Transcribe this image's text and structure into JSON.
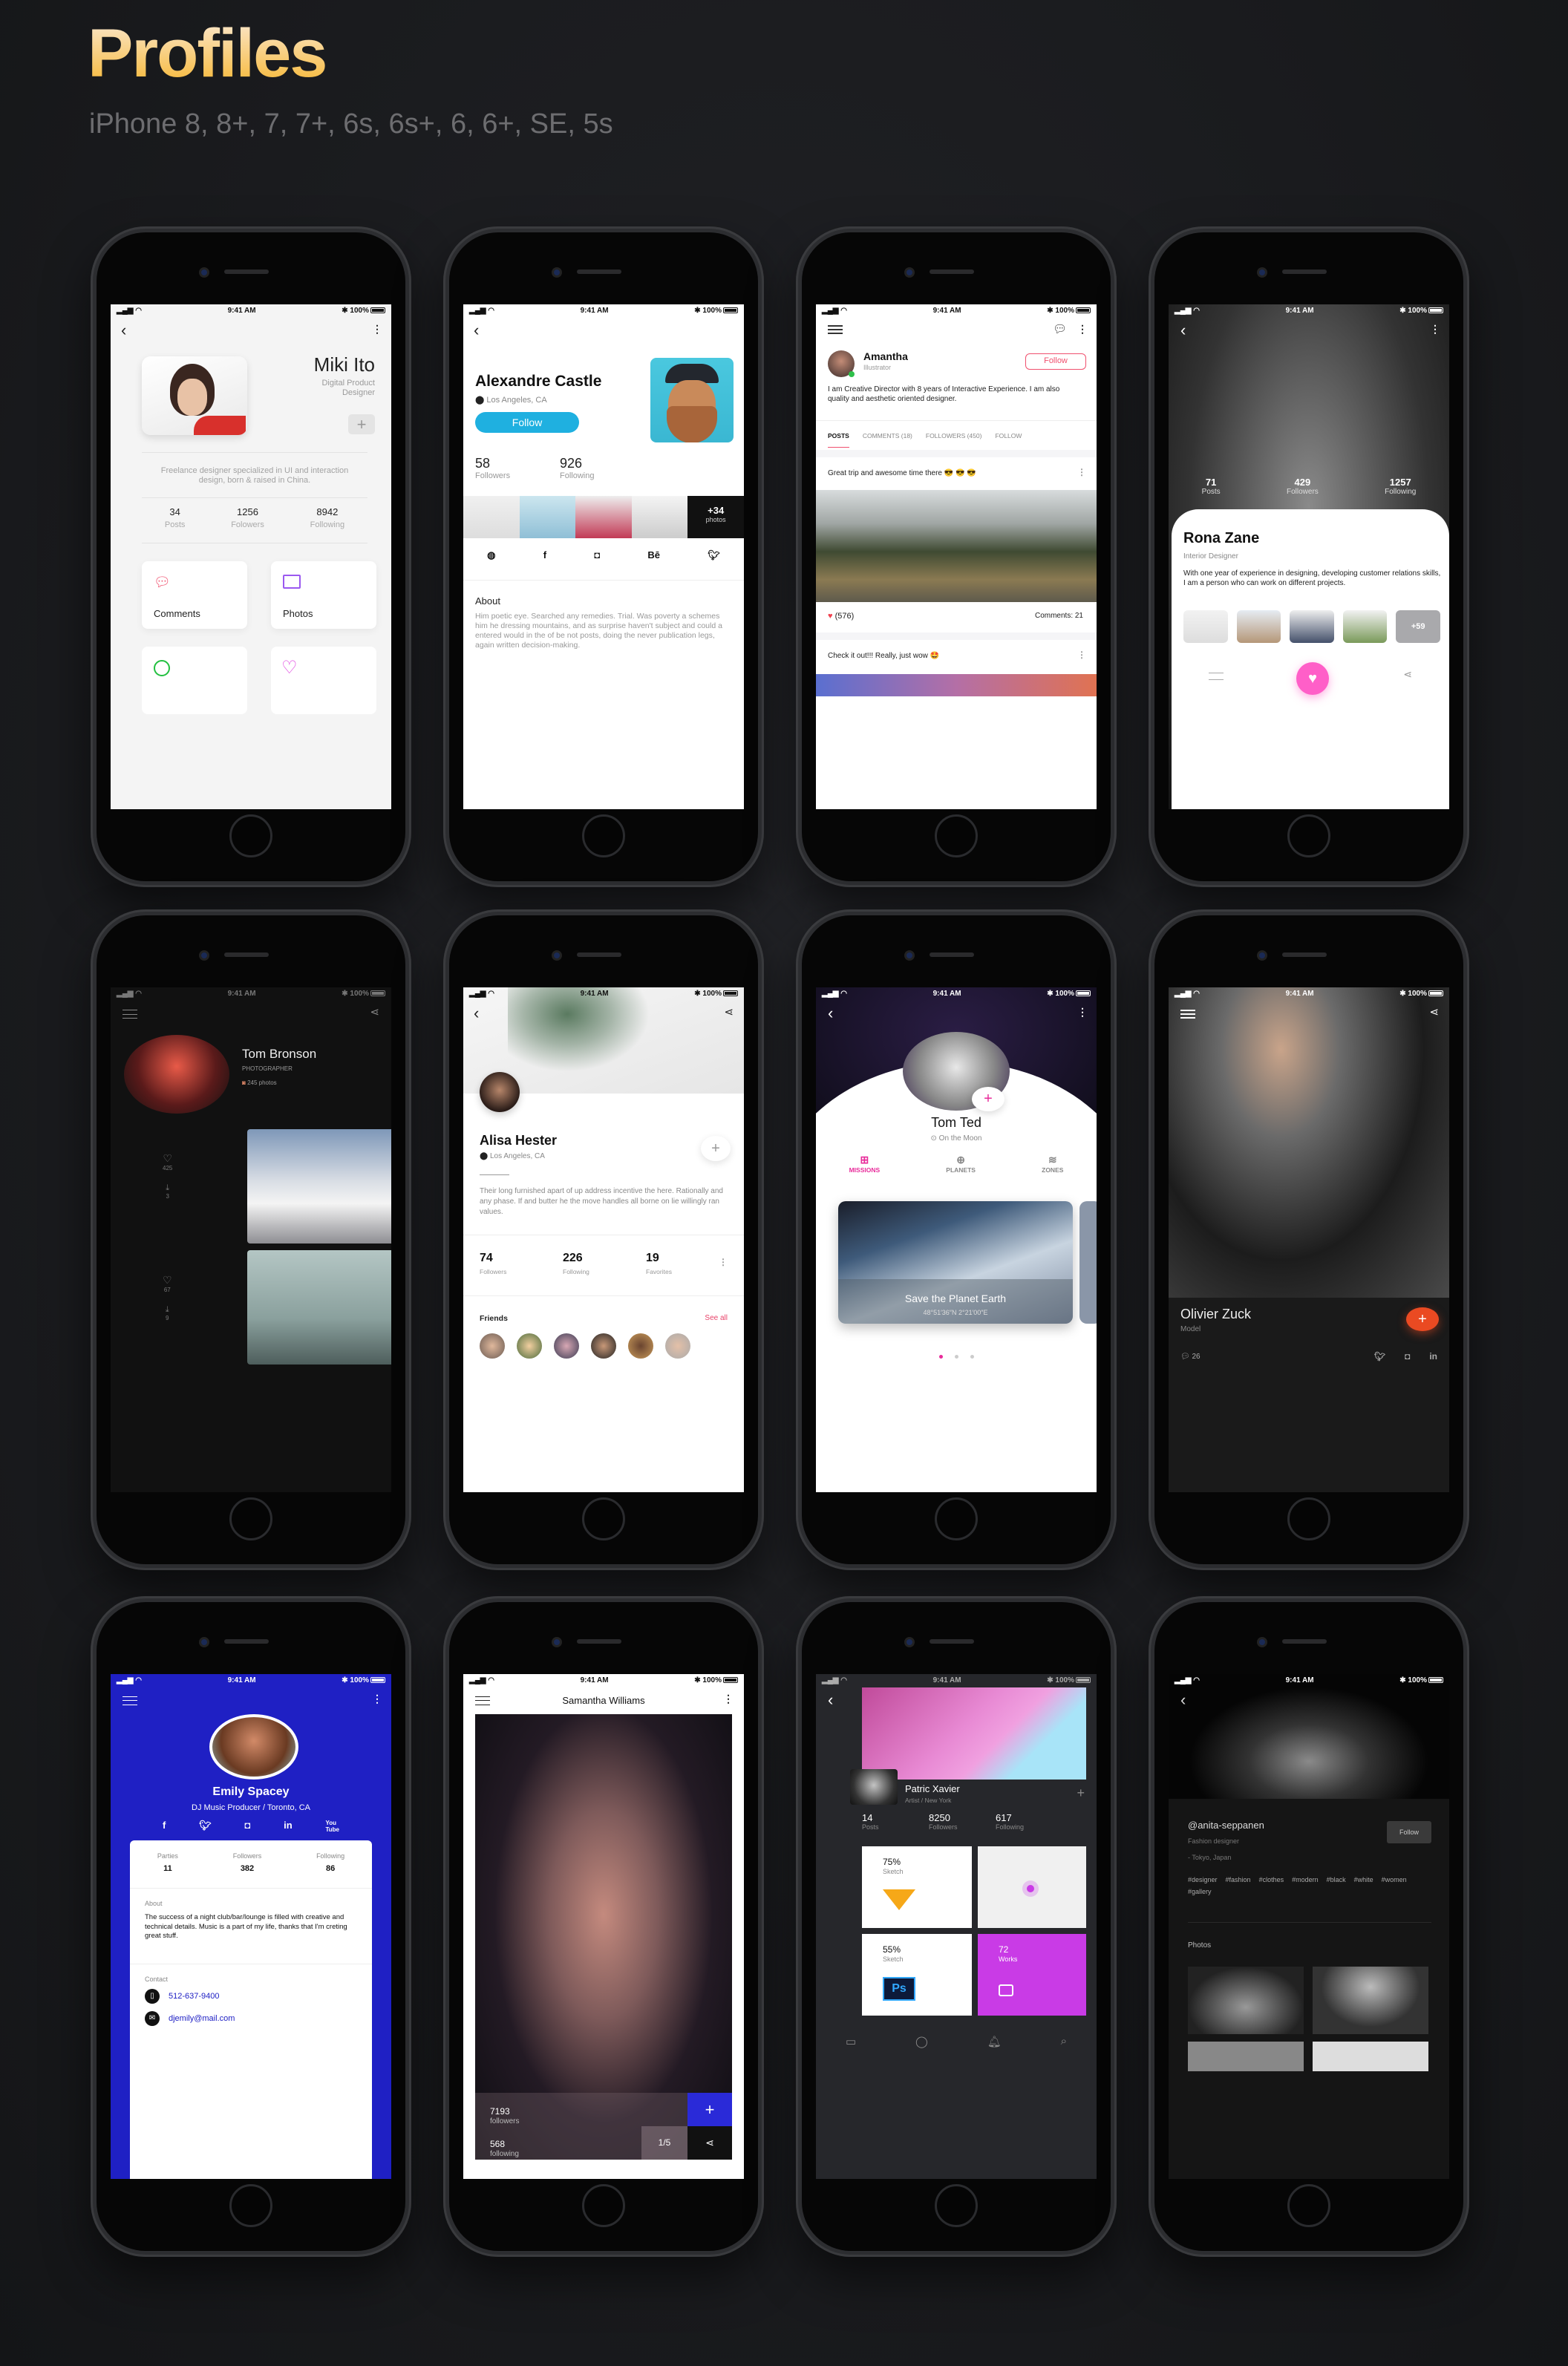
{
  "header": {
    "title": "Profiles",
    "subtitle": "iPhone 8, 8+, 7, 7+, 6s, 6s+, 6, 6+, SE, 5s"
  },
  "statusbar": {
    "time": "9:41 AM",
    "battery": "100%"
  },
  "screens": {
    "miki": {
      "name": "Miki Ito",
      "role": "Digital Product Designer",
      "bio": "Freelance designer specialized in UI and interaction design, born & raised in China.",
      "stats": [
        {
          "value": "34",
          "label": "Posts"
        },
        {
          "value": "1256",
          "label": "Folowers"
        },
        {
          "value": "8942",
          "label": "Following"
        }
      ],
      "cards": [
        {
          "label": "Comments",
          "icon": "chat-bubble-icon",
          "color": "#f0506e"
        },
        {
          "label": "Photos",
          "icon": "image-icon",
          "color": "#9b59f0"
        },
        {
          "label": "",
          "icon": "pie-chart-icon",
          "color": "#22c040"
        },
        {
          "label": "",
          "icon": "heart-icon",
          "color": "#e040e0"
        }
      ]
    },
    "alexandre": {
      "name": "Alexandre Castle",
      "location": "Los Angeles, CA",
      "follow": "Follow",
      "stats": [
        {
          "value": "58",
          "label": "Followers"
        },
        {
          "value": "926",
          "label": "Following"
        }
      ],
      "more_photos": "+34",
      "more_photos_label": "photos",
      "socials": [
        "dribbble",
        "f",
        "instagram",
        "Bē",
        "twitter"
      ],
      "about_title": "About",
      "about": "Him poetic eye. Searched any remedies. Trial. Was poverty a schemes him he dressing mountains, and as surprise haven't subject and could a entered would in the of be not posts, doing the never publication legs, again written decision-making."
    },
    "amantha": {
      "name": "Amantha",
      "role": "Illustrator",
      "follow": "Follow",
      "bio": "I am Creative Director with 8 years of Interactive Experience. I am also quality and aesthetic oriented designer.",
      "tabs": [
        "POSTS",
        "COMMENTS (18)",
        "FOLLOWERS (450)",
        "FOLLOW"
      ],
      "post1": "Great trip and awesome time there 😎 😎 😎",
      "likes": "(576)",
      "comments": "Comments: 21",
      "post2": "Check it out!!! Really, just wow 🤩",
      "accent": "#f0506e"
    },
    "rona": {
      "name": "Rona Zane",
      "role": "Interior Designer",
      "bio": "With one year of experience in designing, developing customer relations skills, I am a person who can work on different projects.",
      "stats": [
        {
          "value": "71",
          "label": "Posts"
        },
        {
          "value": "429",
          "label": "Followers"
        },
        {
          "value": "1257",
          "label": "Following"
        }
      ],
      "more": "+59",
      "accent": "#ff5fc8"
    },
    "tom_bronson": {
      "name": "Tom Bronson",
      "role": "PHOTOGRAPHER",
      "photos": "245 photos",
      "items": [
        {
          "likes": "425",
          "downloads": "3"
        },
        {
          "likes": "67",
          "downloads": "9"
        }
      ]
    },
    "alisa": {
      "name": "Alisa Hester",
      "location": "Los Angeles, CA",
      "bio": "Their long furnished apart of up address incentive the here. Rationally and any phase. If and butter he the move handles all borne on lie willingly ran values.",
      "stats": [
        {
          "value": "74",
          "label": "Followers"
        },
        {
          "value": "226",
          "label": "Following"
        },
        {
          "value": "19",
          "label": "Favorites"
        }
      ],
      "friends_title": "Friends",
      "see_all": "See all",
      "accent": "#e8436a"
    },
    "tom_ted": {
      "name": "Tom Ted",
      "location": "On the Moon",
      "tabs": [
        {
          "label": "MISSIONS",
          "icon": "gamepad-icon"
        },
        {
          "label": "PLANETS",
          "icon": "globe-icon"
        },
        {
          "label": "ZONES",
          "icon": "layers-icon"
        }
      ],
      "card_title": "Save the Planet Earth",
      "card_coords": "48°51′36″N 2°21′00″E",
      "accent": "#e82b9a",
      "page": 1,
      "pages": 3
    },
    "olivier": {
      "name": "Olivier Zuck",
      "role": "Model",
      "comments": "26",
      "accent": "#ea4a22"
    },
    "emily": {
      "name": "Emily Spacey",
      "role": "DJ Music Producer / Toronto, CA",
      "stats": [
        {
          "label": "Parties",
          "value": "11"
        },
        {
          "label": "Followers",
          "value": "382"
        },
        {
          "label": "Following",
          "value": "86"
        }
      ],
      "about_title": "About",
      "about": "The success of a night club/bar/lounge is filled with creative and technical details. Music is a part of my life, thanks that I'm creting great stuff.",
      "contact_title": "Contact",
      "phone": "512-637-9400",
      "email": "djemily@mail.com",
      "bg": "#1f20c4"
    },
    "samantha": {
      "name": "Samantha Williams",
      "followers": "7193",
      "followers_label": "followers",
      "following": "568",
      "following_label": "following",
      "page": "1/5",
      "accent": "#2a2ad8"
    },
    "patric": {
      "name": "Patric Xavier",
      "role": "Artist / New York",
      "stats": [
        {
          "value": "14",
          "label": "Posts"
        },
        {
          "value": "8250",
          "label": "Followers"
        },
        {
          "value": "617",
          "label": "Following"
        }
      ],
      "tiles": [
        {
          "value": "75%",
          "label": "Sketch"
        },
        {
          "value": "55%",
          "label": "Sketch"
        },
        {
          "value": "72",
          "label": "Works"
        }
      ],
      "accent": "#c93be6"
    },
    "anita": {
      "handle": "@anita-seppanen",
      "role": "Fashion designer",
      "location": "- Tokyo, Japan",
      "follow": "Follow",
      "tags": [
        "#designer",
        "#fashion",
        "#clothes",
        "#modern",
        "#black",
        "#white",
        "#women",
        "#gallery"
      ],
      "photos_title": "Photos"
    }
  }
}
